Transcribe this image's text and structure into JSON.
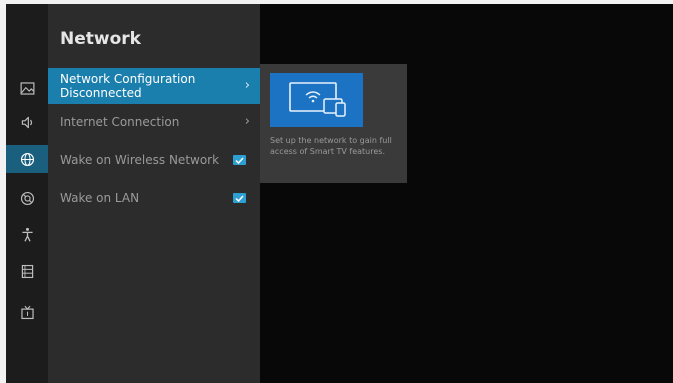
{
  "menu": {
    "title": "Network",
    "items": [
      {
        "label": "Network Configuration",
        "sublabel": "Disconnected"
      },
      {
        "label": "Internet Connection"
      },
      {
        "label": "Wake on Wireless Network",
        "checked": true
      },
      {
        "label": "Wake on LAN",
        "checked": true
      }
    ]
  },
  "info_card": {
    "description": "Set up the network to gain full access of Smart TV features."
  },
  "sidebar": {
    "icons": [
      "picture-icon",
      "sound-icon",
      "network-icon",
      "support-icon",
      "accessibility-icon",
      "system-icon",
      "channel-icon"
    ],
    "active": "network-icon"
  },
  "colors": {
    "accent": "#1b7fae",
    "checkbox": "#2e9fd3",
    "card_image": "#1c73c4"
  }
}
